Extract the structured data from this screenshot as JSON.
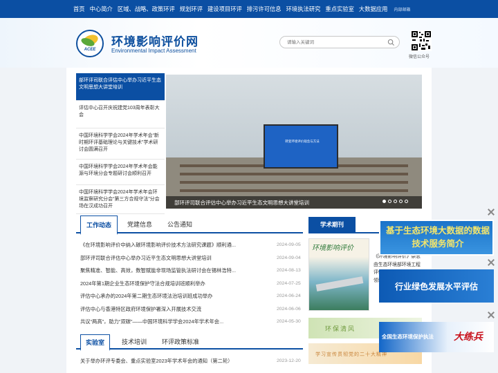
{
  "topnav": {
    "items": [
      "首页",
      "中心简介",
      "区域、战略、政策环评",
      "规划环评",
      "建设项目环评",
      "排污许可信息",
      "环境执法研究",
      "重点实验室",
      "大数据应用"
    ],
    "internal_mail": "内部邮箱"
  },
  "header": {
    "logo_text": "ACEE",
    "title": "环境影响评价网",
    "subtitle": "Environmental Impact Assessment",
    "search_placeholder": "请输入关键词",
    "qr_label": "微信公众号"
  },
  "headlines": [
    "部环评司联合评估中心举办习近平生态文明思想大讲堂培训",
    "评估中心召开庆祝建党103周年表彰大会",
    "中国环境科学学会2024年学术年会“新时期环评基础理论与关键技术”学术研讨会圆满召开",
    "中国环境科学学会2024年学术年会能源与环境分会专题研讨会顺利召开",
    "中国环境科学学会2024年学术年会环境监察研究分会“第三方合规守法”分会场在汉成功召开"
  ],
  "carousel": {
    "screen_text": "转变环境评价观念与方法",
    "caption": "部环评司联合评估中心举办习近平生态文明思想大讲堂培训",
    "dots": 5,
    "active_dot": 0
  },
  "tabs1": [
    "工作动态",
    "党建信息",
    "公告通知"
  ],
  "news1": [
    {
      "title": "《在环境影响评价中纳入碳环境影响评价技术方法研究课题》顺利通...",
      "date": "2024-09-05"
    },
    {
      "title": "部环评司联合评估中心举办习近平生态文明思想大讲堂培训",
      "date": "2024-09-04"
    },
    {
      "title": "聚焦精准、智能、高效，数智赋能非现场监管执法研讨会在锡林浩特...",
      "date": "2024-08-13"
    },
    {
      "title": "2024年第1期企业生态环境保护守法合规培训班顺利举办",
      "date": "2024-07-25"
    },
    {
      "title": "评估中心承办的2024年第二期生态环境法治培训班成功举办",
      "date": "2024-06-24"
    },
    {
      "title": "评估中心与香港特区政府环境保护署深入开展技术交流",
      "date": "2024-06-06"
    },
    {
      "title": "共议“两高”，助力“双碳”——中国环境科学学会2024年学术年会...",
      "date": "2024-05-30"
    }
  ],
  "tabs2": [
    "实验室",
    "技术培训",
    "环评政策标准"
  ],
  "news2": [
    {
      "title": "关于举办环评专委会、重点实验室2023年学术年会的通知（第二轮）",
      "date": "2023-12-20"
    }
  ],
  "journal": {
    "heading": "学术期刊",
    "cover_text": "环境影响评价",
    "description": "《环境影响评价》杂志由生态环境部环境工程评估中心主办，是环评领域专业期刊"
  },
  "banners": {
    "green": "环保清风",
    "yellow": "学习宣传贯彻党的二十大精神"
  },
  "ads": {
    "ad1": "基于生态环境大数据的数据技术服务简介",
    "ad2": "行业绿色发展水平评估",
    "ad3_left": "全国生态环境保护执法",
    "ad3_right": "大练兵"
  }
}
